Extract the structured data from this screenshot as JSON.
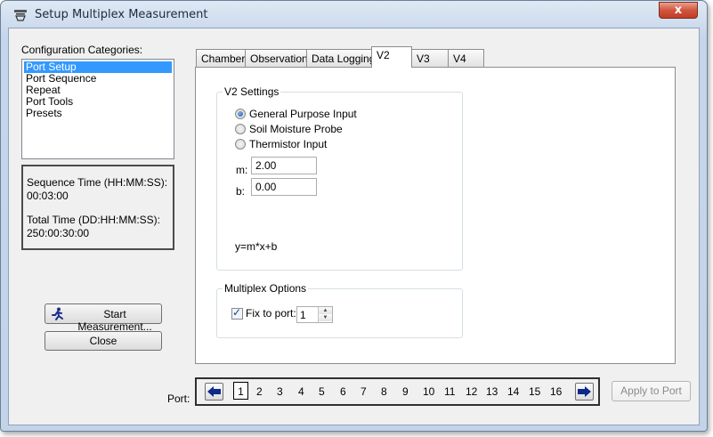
{
  "window": {
    "title": "Setup Multiplex Measurement",
    "close_glyph": "x"
  },
  "sidebar": {
    "categories_label": "Configuration Categories:",
    "categories": [
      {
        "label": "Port Setup",
        "selected": true
      },
      {
        "label": "Port Sequence",
        "selected": false
      },
      {
        "label": "Repeat",
        "selected": false
      },
      {
        "label": "Port Tools",
        "selected": false
      },
      {
        "label": "Presets",
        "selected": false
      }
    ],
    "sequence_time_label": "Sequence Time (HH:MM:SS):",
    "sequence_time_value": "00:03:00",
    "total_time_label": "Total Time (DD:HH:MM:SS):",
    "total_time_value": "250:00:30:00",
    "start_button": "Start Measurement...",
    "close_button": "Close"
  },
  "tabs": [
    {
      "label": "Chamber",
      "active": false
    },
    {
      "label": "Observation",
      "active": false
    },
    {
      "label": "Data Logging",
      "active": false
    },
    {
      "label": "V2",
      "active": true
    },
    {
      "label": "V3",
      "active": false
    },
    {
      "label": "V4",
      "active": false
    }
  ],
  "v2_settings": {
    "group_title": "V2 Settings",
    "options": [
      {
        "label": "General Purpose Input",
        "checked": true
      },
      {
        "label": "Soil Moisture Probe",
        "checked": false
      },
      {
        "label": "Thermistor Input",
        "checked": false
      }
    ],
    "m_label": "m:",
    "m_value": "2.00",
    "b_label": "b:",
    "b_value": "0.00",
    "formula": "y=m*x+b"
  },
  "multiplex_options": {
    "group_title": "Multiplex Options",
    "fix_to_port_label": "Fix to port:",
    "fix_to_port_checked": true,
    "port_value": "1"
  },
  "port_selector": {
    "label": "Port:",
    "ports": [
      "1",
      "2",
      "3",
      "4",
      "5",
      "6",
      "7",
      "8",
      "9",
      "10",
      "11",
      "12",
      "13",
      "14",
      "15",
      "16"
    ],
    "selected_port": "1",
    "prev_glyph": "🡐",
    "next_glyph": "🡒",
    "apply_button": "Apply to Port"
  },
  "colors": {
    "selection": "#3399ff",
    "arrow": "#0b2a8a",
    "close_red": "#c23d23"
  }
}
